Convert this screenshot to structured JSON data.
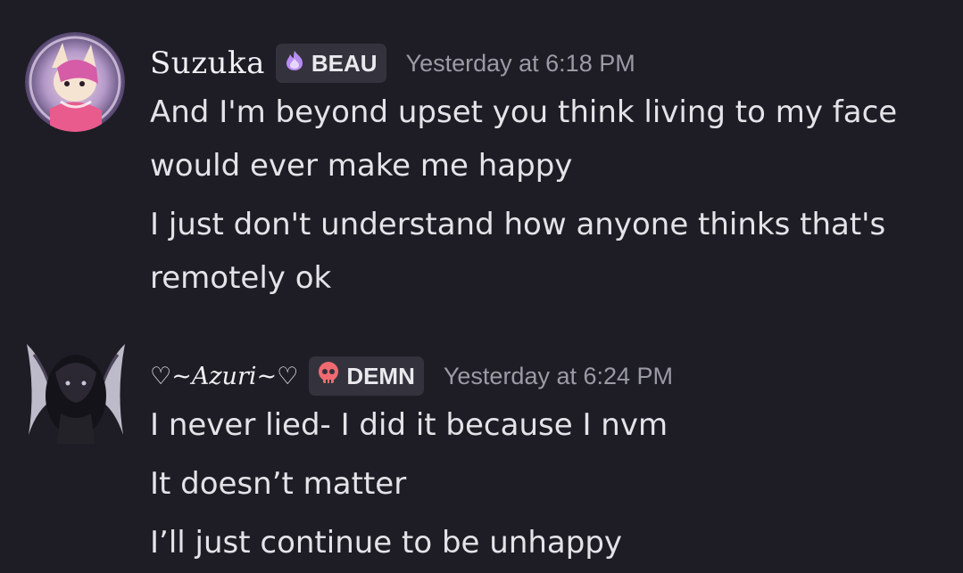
{
  "messages": [
    {
      "username": "Suzuka",
      "tag": "BEAU",
      "tag_icon": "purple-flame-icon",
      "timestamp": "Yesterday at 6:18 PM",
      "lines": [
        "And I'm beyond upset you think living to my face",
        "would ever make me happy",
        "I just don't understand how anyone thinks that's",
        "remotely ok"
      ]
    },
    {
      "username": "♡~Azuri~♡",
      "tag": "DEMN",
      "tag_icon": "red-skull-icon",
      "timestamp": "Yesterday at 6:24 PM",
      "lines": [
        "I never lied- I did it because I nvm",
        "It doesn’t matter",
        "I’ll just continue to be unhappy"
      ]
    }
  ],
  "colors": {
    "background": "#1e1d25",
    "tag_background": "#34333d",
    "timestamp": "#9b9ba6",
    "text": "#e3e3e8"
  }
}
